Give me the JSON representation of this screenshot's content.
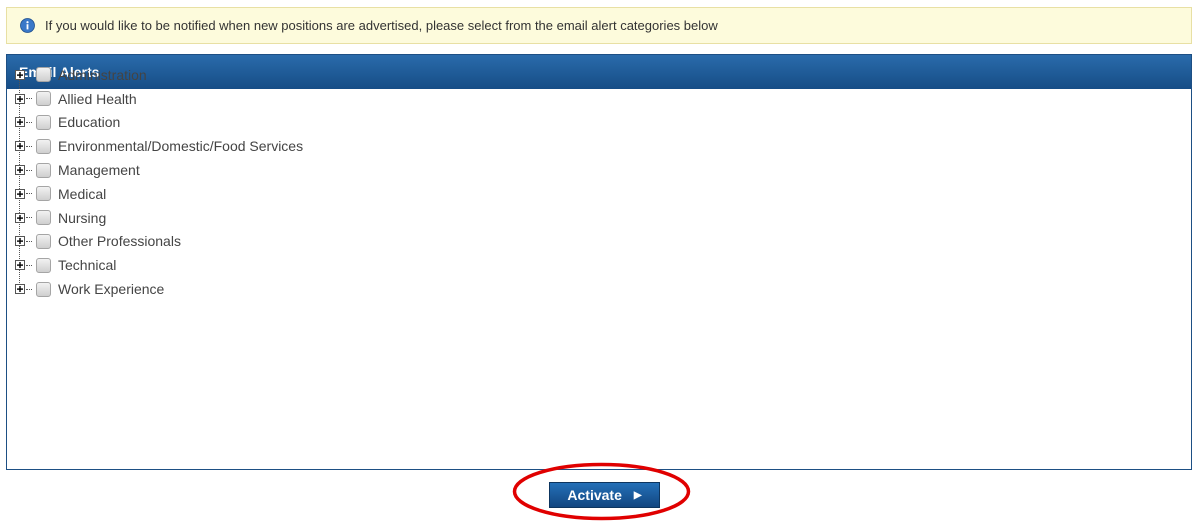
{
  "notice": {
    "text": "If you would like to be notified when new positions are advertised, please select from the email alert categories below",
    "icon": "info-icon"
  },
  "panel": {
    "title": "Email Alerts",
    "categories": [
      "Administration",
      "Allied Health",
      "Education",
      "Environmental/Domestic/Food Services",
      "Management",
      "Medical",
      "Nursing",
      "Other Professionals",
      "Technical",
      "Work Experience"
    ]
  },
  "actions": {
    "activate_label": "Activate",
    "arrow": "▶"
  },
  "colors": {
    "header": "#1d5a96",
    "button": "#1a5a9a",
    "highlight_ring": "#e00000",
    "notice_bg": "#fdfbdc"
  }
}
